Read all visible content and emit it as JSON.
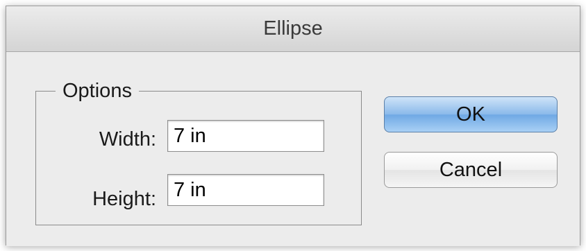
{
  "window": {
    "title": "Ellipse"
  },
  "options": {
    "legend": "Options",
    "width_label": "Width:",
    "width_value": "7 in",
    "height_label": "Height:",
    "height_value": "7 in"
  },
  "buttons": {
    "ok_label": "OK",
    "cancel_label": "Cancel"
  },
  "colors": {
    "default_button": "#8ab9ea",
    "dialog_background": "#ececec"
  }
}
